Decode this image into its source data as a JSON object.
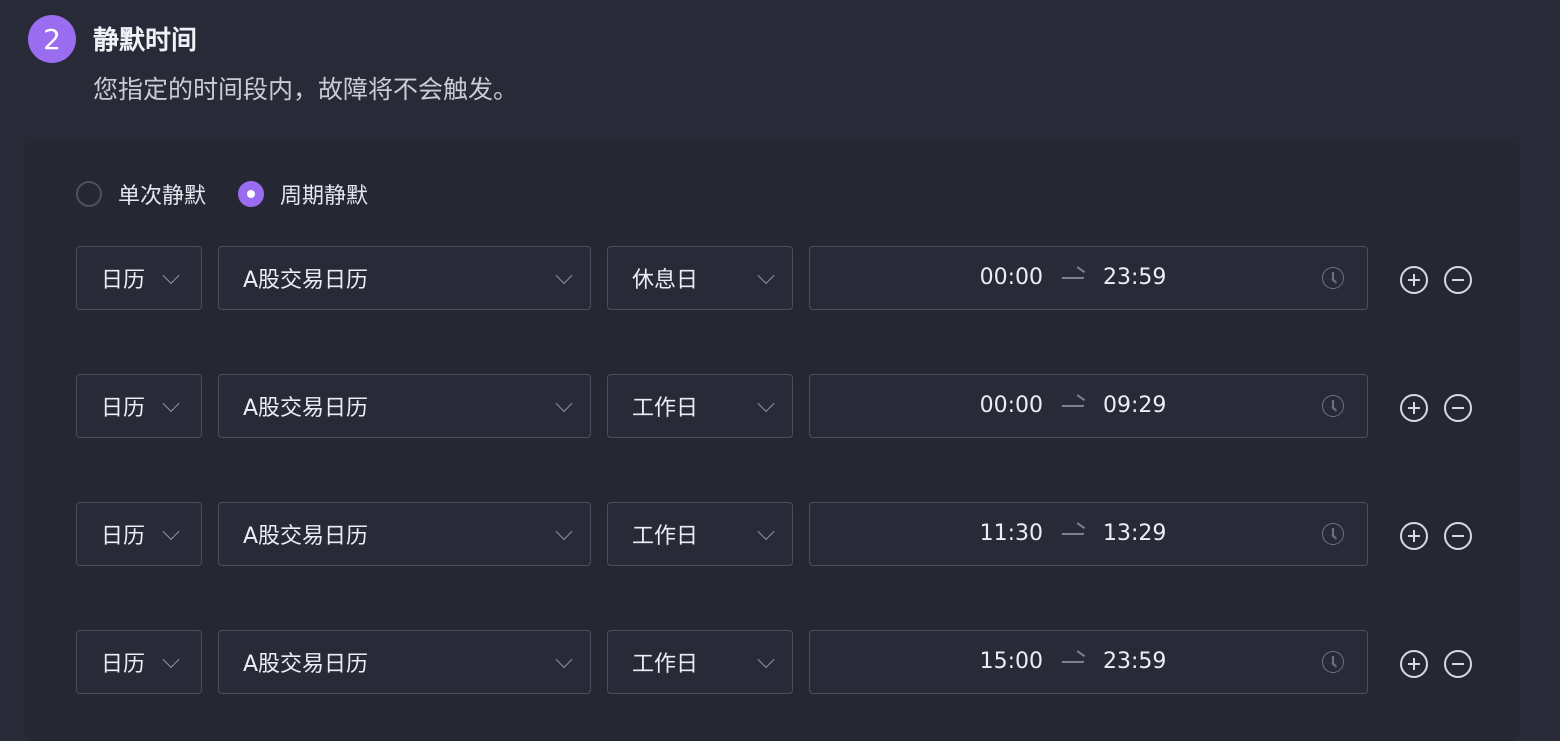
{
  "section": {
    "step": "2",
    "title": "静默时间",
    "description": "您指定的时间段内，故障将不会触发。"
  },
  "mode": {
    "options": [
      {
        "label": "单次静默",
        "checked": false
      },
      {
        "label": "周期静默",
        "checked": true
      }
    ]
  },
  "rows": [
    {
      "type": "日历",
      "calendar": "A股交易日历",
      "day": "休息日",
      "start": "00:00",
      "end": "23:59"
    },
    {
      "type": "日历",
      "calendar": "A股交易日历",
      "day": "工作日",
      "start": "00:00",
      "end": "09:29"
    },
    {
      "type": "日历",
      "calendar": "A股交易日历",
      "day": "工作日",
      "start": "11:30",
      "end": "13:29"
    },
    {
      "type": "日历",
      "calendar": "A股交易日历",
      "day": "工作日",
      "start": "15:00",
      "end": "23:59"
    }
  ],
  "icons": {
    "chevron": "chevron-down-icon",
    "clock": "clock-icon",
    "add": "plus-circle-icon",
    "remove": "minus-circle-icon",
    "arrow": "arrow-right-icon"
  },
  "colors": {
    "background": "#282a38",
    "accent": "#9a6cf0",
    "border": "#4a4d5c"
  }
}
